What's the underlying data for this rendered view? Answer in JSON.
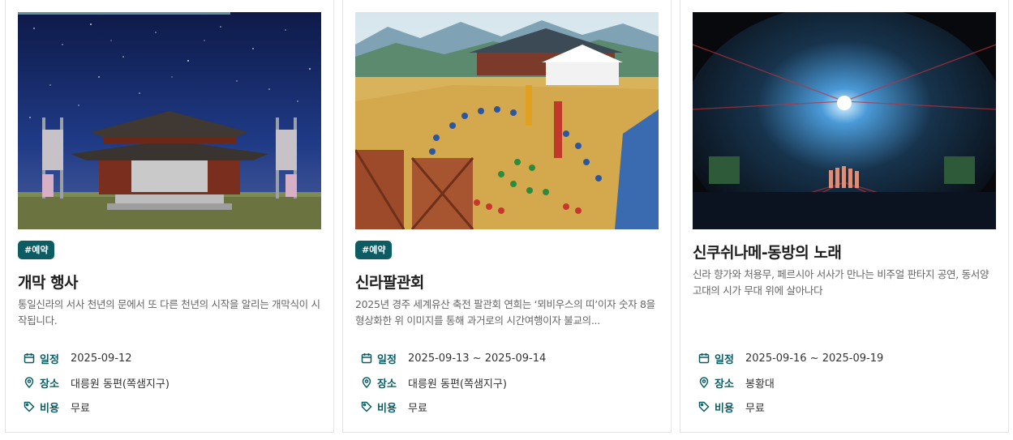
{
  "cards": [
    {
      "tag": "#예약",
      "title": "개막 행사",
      "description": "통일신라의 서사 천년의 문에서 또 다른 천년의 시작을 알리는 개막식이 시작됩니다.",
      "schedule_label": "일정",
      "schedule_value": "2025-09-12",
      "place_label": "장소",
      "place_value": "대릉원 동편(쪽샘지구)",
      "cost_label": "비용",
      "cost_value": "무료"
    },
    {
      "tag": "#예약",
      "title": "신라팔관회",
      "description": "2025년 경주 세계유산 축전 팔관회 연희는 ‘뫼비우스의 띠’이자 숫자 8을 형상화한 위 이미지를 통해 과거로의 시간여행이자 불교의...",
      "schedule_label": "일정",
      "schedule_value": "2025-09-13 ~ 2025-09-14",
      "place_label": "장소",
      "place_value": "대릉원 동편(쪽샘지구)",
      "cost_label": "비용",
      "cost_value": "무료"
    },
    {
      "title": "신쿠쉬나메-동방의 노래",
      "description": "신라 향가와 처용무, 페르시아 서사가 만나는 비주얼 판타지 공연, 동서양 고대의 시가 무대 위에 살아나다",
      "schedule_label": "일정",
      "schedule_value": "2025-09-16 ~ 2025-09-19",
      "place_label": "장소",
      "place_value": "봉황대",
      "cost_label": "비용",
      "cost_value": "무료"
    }
  ],
  "icons": {
    "schedule": "calendar-icon",
    "place": "location-pin-icon",
    "cost": "price-tag-icon"
  },
  "colors": {
    "accent": "#0d5c63",
    "title": "#1e1e1e",
    "description": "#666666"
  }
}
